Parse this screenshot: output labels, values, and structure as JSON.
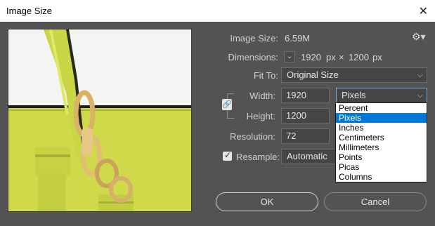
{
  "window": {
    "title": "Image Size"
  },
  "image_size": {
    "label": "Image Size:",
    "value": "6.59M"
  },
  "dimensions": {
    "label": "Dimensions:",
    "width": "1920",
    "width_unit": "px",
    "times": "×",
    "height": "1200",
    "height_unit": "px"
  },
  "fit_to": {
    "label": "Fit To:",
    "value": "Original Size"
  },
  "width": {
    "label": "Width:",
    "value": "1920"
  },
  "height": {
    "label": "Height:",
    "value": "1200"
  },
  "resolution": {
    "label": "Resolution:",
    "value": "72"
  },
  "resample": {
    "label": "Resample:",
    "value": "Automatic",
    "checked": true
  },
  "unit_select": {
    "value": "Pixels"
  },
  "unit_options": [
    "Percent",
    "Pixels",
    "Inches",
    "Centimeters",
    "Millimeters",
    "Points",
    "Picas",
    "Columns"
  ],
  "unit_selected_index": 1,
  "buttons": {
    "ok": "OK",
    "cancel": "Cancel"
  },
  "colors": {
    "dialog_bg": "#535353",
    "selection_blue": "#0078d7",
    "preview_lime": "#d4e04a"
  },
  "icons": {
    "close": "close-icon",
    "settings": "gear-icon",
    "link": "chain-link-icon"
  }
}
